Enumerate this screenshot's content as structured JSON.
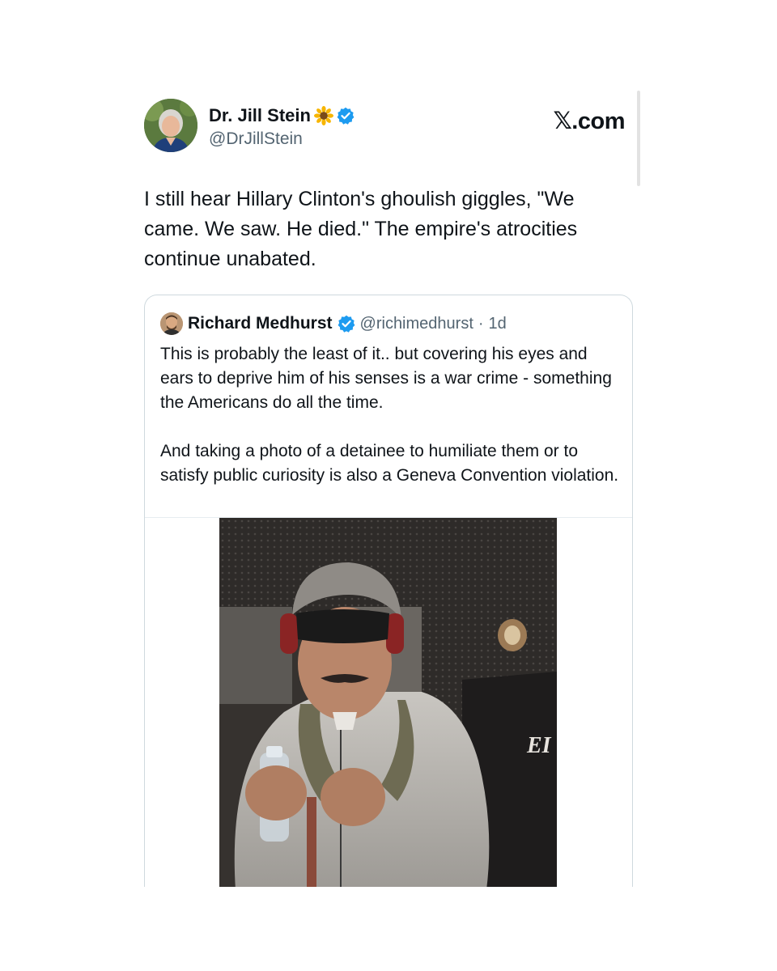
{
  "post": {
    "author_name": "Dr. Jill Stein",
    "author_handle": "@DrJillStein",
    "source_label": "𝕏.com",
    "name_emoji": "sunflower-icon",
    "text": "I still hear Hillary Clinton's ghoulish giggles, \"We came. We saw. He died.\" The empire's atrocities continue unabated."
  },
  "quote": {
    "author_name": "Richard Medhurst",
    "author_handle": "@richimedhurst",
    "separator": "·",
    "time": "1d",
    "paragraph_1": "This is probably the least of it.. but covering his eyes and ears to deprive him of his senses is a war crime - something the Americans do all the time.",
    "paragraph_2": "And taking a photo of a detainee to humiliate them or to satisfy public curiosity is also a Geneva Convention violation."
  },
  "colors": {
    "verified_blue": "#1d9bf0",
    "text_primary": "#0f1419",
    "text_secondary": "#536471",
    "border": "#cfd9de"
  }
}
